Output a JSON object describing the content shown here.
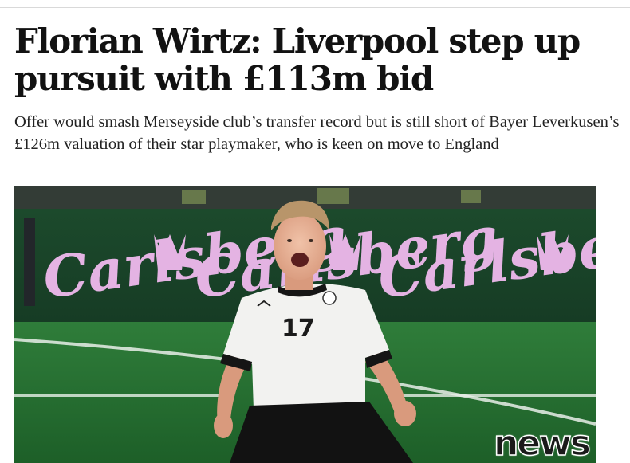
{
  "article": {
    "headline": "Florian Wirtz: Liverpool step up pursuit with £113m bid",
    "standfirst": "Offer would smash Merseyside club’s transfer record but is still short of Bayer Leverkusen’s £126m valuation of their star playmaker, who is keen on move to England"
  },
  "photo": {
    "board_text": "Carlsberg",
    "shirt_number": "17"
  },
  "watermark": {
    "text": "news"
  }
}
